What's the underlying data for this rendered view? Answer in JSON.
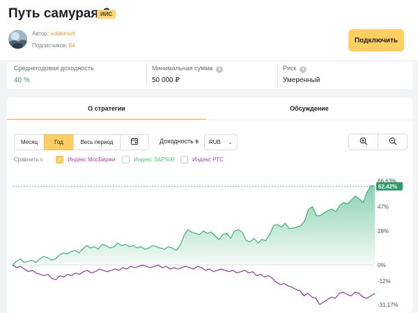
{
  "header": {
    "title": "Путь самурая-2",
    "badge": "ИИС",
    "author_label": "Автор:",
    "author_name": "voldemort",
    "subscribers_label": "Подписчиков:",
    "subscribers_count": "84",
    "connect_button": "Подключить"
  },
  "stats": [
    {
      "label": "Среднегодовая доходность",
      "value": "40 %"
    },
    {
      "label": "Минимальная сумма",
      "value": "50 000 ₽"
    },
    {
      "label": "Риск",
      "value": "Умеренный"
    }
  ],
  "tabs": [
    {
      "label": "О стратегии",
      "active": true
    },
    {
      "label": "Обсуждение",
      "active": false
    }
  ],
  "controls": {
    "periods": [
      "Месяц",
      "Год",
      "Весь период"
    ],
    "active_period": "Год",
    "yield_label": "Доходность в",
    "currency": "RUB",
    "compare_label": "Сравнить с",
    "compare": [
      {
        "label": "Индекс МосБиржи",
        "checked": true,
        "color": "#b33fae"
      },
      {
        "label": "Индекс S&P500",
        "checked": false,
        "color": "#52c47e"
      },
      {
        "label": "Индекс РТС",
        "checked": false,
        "color": "#8b4fc2"
      }
    ]
  },
  "colors": {
    "accent": "#ffd061",
    "strategy_line": "#3bb27c",
    "moex_line": "#8e3a99",
    "current_badge": "#2e9d6a"
  },
  "icons": [
    "calendar-icon",
    "zoom-in-icon",
    "zoom-out-icon",
    "info-icon",
    "check-icon",
    "chevron-down-icon"
  ],
  "chart_data": {
    "type": "line",
    "y_ticks": [
      "66.63%",
      "47%",
      "28%",
      "0%",
      "-12%",
      "-31.17%"
    ],
    "current_label": "62.42%",
    "ylim": [
      -31.17,
      66.63
    ],
    "series": [
      {
        "color": "#3bb27c",
        "fill": true,
        "values": [
          0,
          3,
          5,
          2,
          3,
          4,
          2,
          5,
          7,
          6,
          4,
          5,
          8,
          10,
          9,
          11,
          12,
          10,
          13,
          16,
          14,
          15,
          13,
          17,
          16,
          14,
          15,
          18,
          16,
          17,
          15,
          16,
          14,
          15,
          13,
          14,
          16,
          15,
          14,
          13,
          15,
          14,
          12,
          16,
          24,
          29,
          27,
          26,
          25,
          28,
          26,
          27,
          24,
          21,
          25,
          26,
          22,
          28,
          29,
          27,
          20,
          19,
          22,
          18,
          21,
          20,
          25,
          32,
          33,
          31,
          34,
          30,
          30,
          31,
          32,
          36,
          45,
          47,
          40,
          40,
          42,
          44,
          45,
          43,
          48,
          50,
          49,
          52,
          55,
          53,
          50,
          58,
          63,
          62.42
        ]
      },
      {
        "color": "#8e3a99",
        "fill": false,
        "values": [
          0,
          -2,
          -1,
          -3,
          -5,
          -4,
          -6,
          -7,
          -8,
          -7,
          -10,
          -11,
          -8,
          -9,
          -7,
          -8,
          -6,
          -7,
          -5,
          -4,
          -6,
          -5,
          -3,
          -4,
          -5,
          -4,
          -3,
          -4,
          -2,
          -3,
          -1,
          -2,
          -1,
          0,
          -1,
          -2,
          -1,
          0,
          -2,
          -1,
          -3,
          -2,
          -3,
          -2,
          -1,
          -2,
          -3,
          -1,
          -2,
          -4,
          -3,
          -5,
          -4,
          -3,
          -4,
          -5,
          -4,
          -6,
          -5,
          -4,
          -6,
          -5,
          -8,
          -7,
          -9,
          -8,
          -10,
          -13,
          -15,
          -14,
          -16,
          -17,
          -19,
          -20,
          -24,
          -22,
          -25,
          -26,
          -31,
          -29,
          -27,
          -25,
          -26,
          -22,
          -21,
          -23,
          -24,
          -21,
          -22,
          -25,
          -26,
          -24,
          -22
        ]
      }
    ]
  }
}
